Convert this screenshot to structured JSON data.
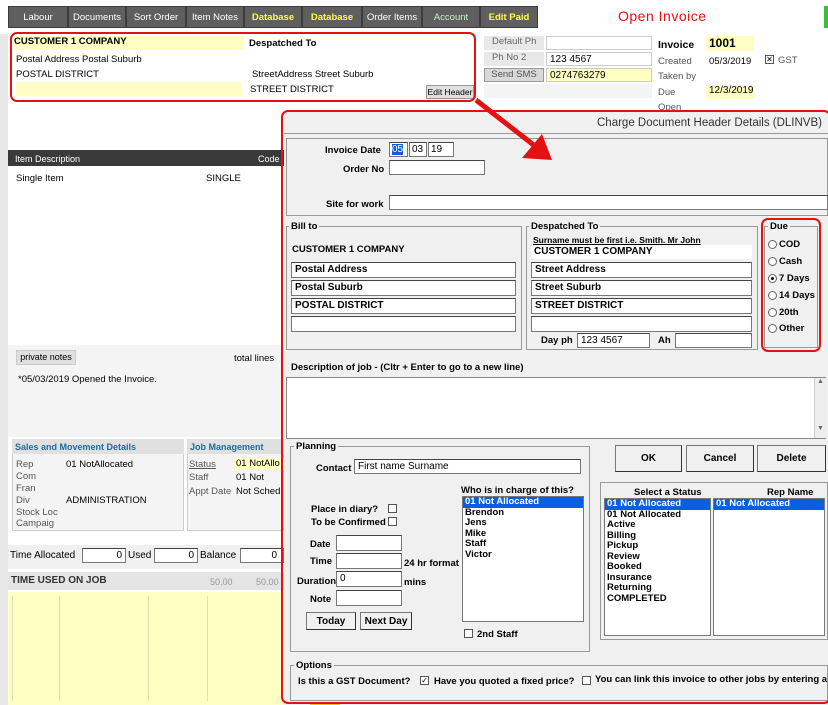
{
  "toolbar": {
    "labour": "Labour",
    "documents": "Documents",
    "sort_order": "Sort Order",
    "item_notes": "Item Notes",
    "database1": "Database",
    "database2": "Database",
    "order_items": "Order Items",
    "account": "Account",
    "edit_paid": "Edit Paid"
  },
  "invoice_status": "Open Invoice",
  "header_panel": {
    "customer": "CUSTOMER 1 COMPANY",
    "despatched_to_label": "Despatched To",
    "postal_address": "Postal Address Postal Suburb",
    "postal_district": "POSTAL DISTRICT",
    "street_address": "StreetAddress Street Suburb",
    "street_district": "STREET DISTRICT",
    "edit_header": "Edit Header"
  },
  "phones": {
    "default_ph_label": "Default Ph",
    "ph_no2_label": "Ph No 2",
    "ph_no2": "123 4567",
    "send_sms": "Send SMS",
    "sms_no": "0274763279"
  },
  "invoice_info": {
    "invoice_label": "Invoice",
    "invoice_no": "1001",
    "created_label": "Created",
    "created": "05/3/2019",
    "gst": "GST",
    "taken_by_label": "Taken by",
    "due_label": "Due",
    "due": "12/3/2019",
    "open_label": "Open"
  },
  "items": {
    "desc_header": "Item Description",
    "code_header": "Code",
    "row_desc": "Single Item",
    "row_code": "SINGLE"
  },
  "notes": {
    "private_notes": "private notes",
    "total_lines": "total lines",
    "note": "*05/03/2019 Opened the Invoice."
  },
  "sales": {
    "title": "Sales and Movement Details",
    "rep_label": "Rep",
    "rep": "01 NotAllocated",
    "com_label": "Com",
    "fran_label": "Fran",
    "div_label": "Div",
    "div": "ADMINISTRATION",
    "stock_label": "Stock Loc",
    "campaign_label": "Campaig"
  },
  "job": {
    "title": "Job Management",
    "status_label": "Status",
    "status": "01 NotAllo",
    "staff_label": "Staff",
    "staff": "01 Not",
    "appt_label": "Appt Date",
    "appt": "Not Sched"
  },
  "time": {
    "allocated_label": "Time Allocated",
    "allocated": "0",
    "used_label": "Used",
    "used": "0",
    "balance_label": "Balance",
    "balance": "0",
    "used_on_job": "TIME USED ON JOB",
    "v1": "50.00",
    "v2": "50.00"
  },
  "dialog": {
    "title": "Charge Document Header Details (DLINVB)",
    "invoice_date_label": "Invoice Date",
    "date_d": "05",
    "date_m": "03",
    "date_y": "19",
    "order_no_label": "Order No",
    "site_label": "Site for work",
    "bill_to": {
      "title": "Bill to",
      "name": "CUSTOMER 1 COMPANY",
      "l1": "Postal Address",
      "l2": "Postal Suburb",
      "l3": "POSTAL DISTRICT"
    },
    "despatch": {
      "title": "Despatched To",
      "hint": "Surname must be first i.e. Smith. Mr John",
      "name": "CUSTOMER 1 COMPANY",
      "l1": "Street Address",
      "l2": "Street Suburb",
      "l3": "STREET DISTRICT",
      "day_ph_label": "Day ph",
      "day_ph": "123 4567",
      "ah_label": "Ah"
    },
    "due": {
      "title": "Due",
      "options": [
        "COD",
        "Cash",
        "7 Days",
        "14 Days",
        "20th",
        "Other"
      ],
      "selected": "7 Days"
    },
    "desc_label": "Description of job - (Cltr + Enter to go to a new line)",
    "planning": {
      "title": "Planning",
      "contact_label": "Contact",
      "contact": "First name Surname",
      "diary_label": "Place in diary?",
      "confirmed_label": "To be Confirmed",
      "date_label": "Date",
      "time_label": "Time",
      "hr24": "24 hr format",
      "duration_label": "Duration",
      "duration": "0",
      "mins": "mins",
      "note_label": "Note",
      "today": "Today",
      "next_day": "Next Day"
    },
    "in_charge": {
      "label": "Who is in charge of this?",
      "items": [
        "01 Not Allocated",
        "Brendon",
        "Jens",
        "Mike",
        "Staff",
        "Victor"
      ],
      "second_staff": "2nd Staff"
    },
    "ok": "OK",
    "cancel": "Cancel",
    "delete": "Delete",
    "status": {
      "label": "Select a Status",
      "items": [
        "01 Not Allocated",
        "01 Not Allocated",
        "Active",
        "Billing",
        "Pickup",
        "Review",
        "Booked",
        "Insurance",
        "Returning",
        "COMPLETED"
      ]
    },
    "rep": {
      "label": "Rep Name",
      "items": [
        "01 Not Allocated"
      ]
    },
    "options": {
      "title": "Options",
      "gst_q": "Is this a GST Document?",
      "fixed_q": "Have you quoted a fixed price?",
      "link_q": "You can link this invoice to other jobs by entering a"
    }
  },
  "colors": {
    "toolbar": "#5f5f5f",
    "status_red": "#e51010",
    "yellow_field": "#ffffc4",
    "selection": "#0a5fe0"
  }
}
